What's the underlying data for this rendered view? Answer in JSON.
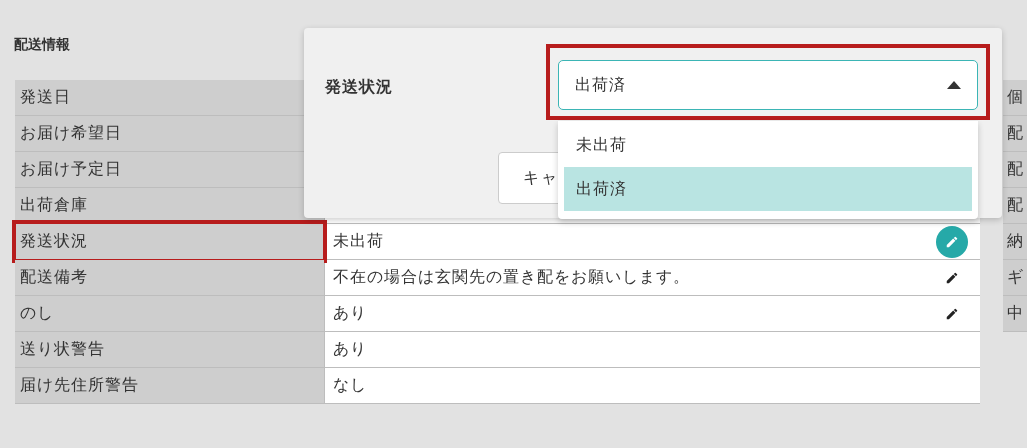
{
  "section_title": "配送情報",
  "rows": [
    {
      "label": "発送日",
      "kind": "static",
      "highlighted": false
    },
    {
      "label": "お届け希望日",
      "kind": "static",
      "highlighted": false
    },
    {
      "label": "お届け予定日",
      "kind": "static",
      "highlighted": false
    },
    {
      "label": "出荷倉庫",
      "kind": "static",
      "highlighted": false
    },
    {
      "label": "発送状況",
      "value": "未出荷",
      "kind": "active_edit",
      "highlighted": true
    },
    {
      "label": "配送備考",
      "value": "不在の場合は玄関先の置き配をお願いします。",
      "kind": "editable",
      "highlighted": false
    },
    {
      "label": "のし",
      "value": "あり",
      "kind": "editable",
      "highlighted": false
    },
    {
      "label": "送り状警告",
      "value": "あり",
      "kind": "static",
      "highlighted": false
    },
    {
      "label": "届け先住所警告",
      "value": "なし",
      "kind": "static",
      "highlighted": false
    }
  ],
  "side_labels": [
    "個",
    "配",
    "配",
    "配",
    "納",
    "ギ",
    "中"
  ],
  "dialog": {
    "label": "発送状況",
    "select": {
      "value": "出荷済",
      "expanded": true,
      "highlighted": true
    },
    "options": [
      {
        "label": "未出荷",
        "selected": false
      },
      {
        "label": "出荷済",
        "selected": true
      }
    ],
    "cancel_button": "キャ"
  }
}
